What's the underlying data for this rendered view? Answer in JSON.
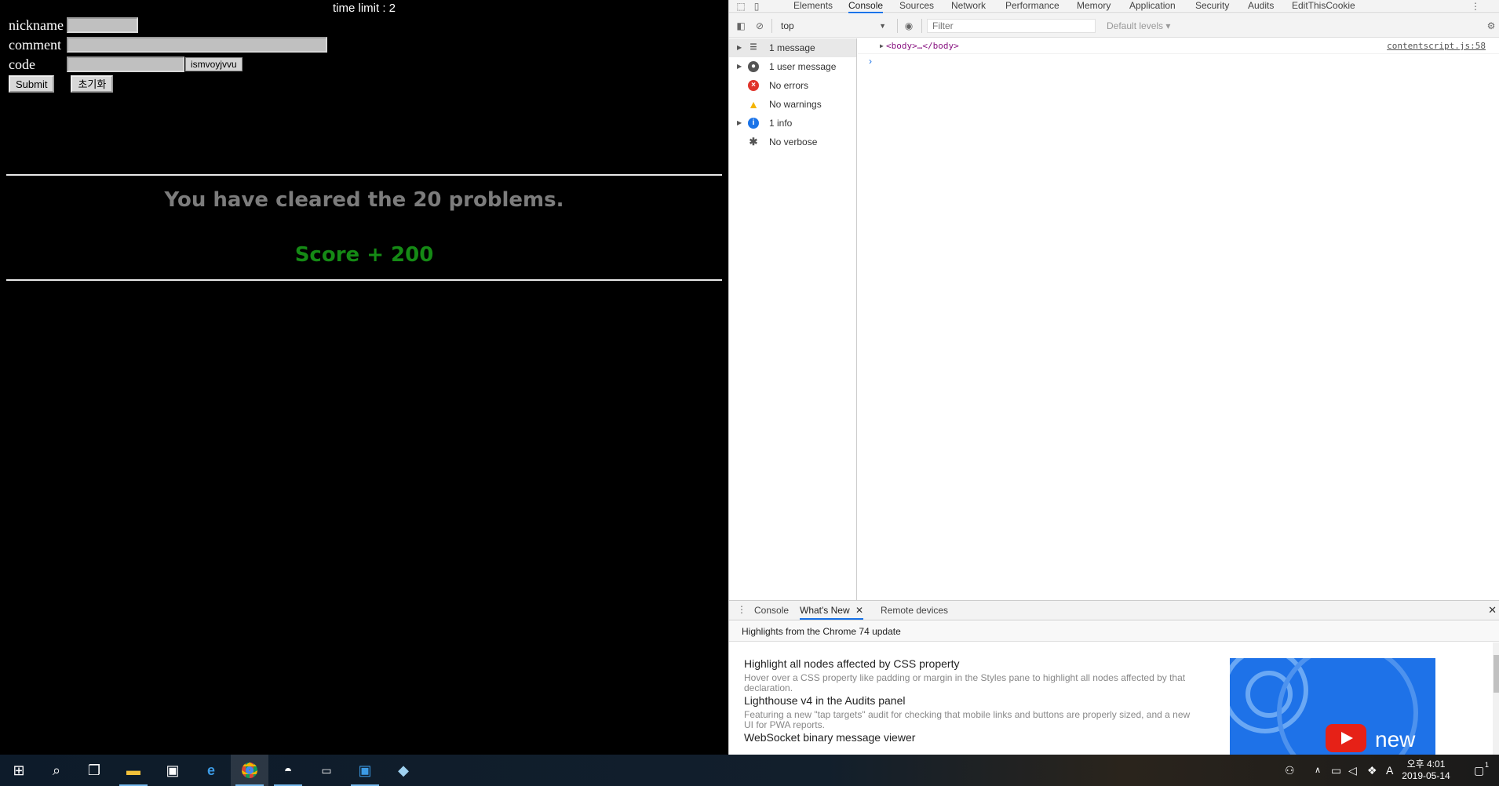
{
  "page": {
    "time_limit": "time limit : 2",
    "form": {
      "nickname_label": "nickname",
      "nickname_value": "",
      "comment_label": "comment",
      "comment_value": "",
      "code_label": "code",
      "code_value": "",
      "code_chip": "ismvoyjvvu",
      "submit_label": "Submit",
      "reset_label": "초기화"
    },
    "cleared_text": "You have cleared the 20 problems.",
    "score_text": "Score + 200"
  },
  "devtools": {
    "tabs": [
      "Elements",
      "Console",
      "Sources",
      "Network",
      "Performance",
      "Memory",
      "Application",
      "Security",
      "Audits",
      "EditThisCookie"
    ],
    "active_tab": "Console",
    "context": "top",
    "filter_placeholder": "Filter",
    "levels": "Default levels ▾",
    "sidebar": [
      {
        "label": "1 message",
        "icon": "list-icon"
      },
      {
        "label": "1 user message",
        "icon": "user-icon"
      },
      {
        "label": "No errors",
        "icon": "error-icon"
      },
      {
        "label": "No warnings",
        "icon": "warning-icon"
      },
      {
        "label": "1 info",
        "icon": "info-icon"
      },
      {
        "label": "No verbose",
        "icon": "bug-icon"
      }
    ],
    "console_entry": {
      "tag": "<body>…</body>",
      "source": "contentscript.js:58"
    },
    "drawer_tabs": [
      "Console",
      "What's New",
      "Remote devices"
    ],
    "whats_new": {
      "header": "Highlights from the Chrome 74 update",
      "items": [
        {
          "title": "Highlight all nodes affected by CSS property",
          "desc": "Hover over a CSS property like padding or margin in the Styles pane to highlight all nodes affected by that declaration."
        },
        {
          "title": "Lighthouse v4 in the Audits panel",
          "desc": "Featuring a new \"tap targets\" audit for checking that mobile links and buttons are properly sized, and a new UI for PWA reports."
        },
        {
          "title": "WebSocket binary message viewer",
          "desc": ""
        }
      ],
      "thumb_text": "new"
    }
  },
  "taskbar": {
    "apps": [
      "windows-start-icon",
      "search-icon",
      "task-view-icon",
      "file-explorer-icon",
      "store-icon",
      "edge-icon",
      "chrome-icon",
      "paint-icon",
      "terminal-icon",
      "app-icon",
      "notepad-icon"
    ],
    "clock_time": "오후 4:01",
    "clock_date": "2019-05-14",
    "ime": "A",
    "notification_count": "1"
  },
  "colors": {
    "score_green": "#158a15",
    "cleared_gray": "#7c7c7c",
    "accent_blue": "#1a73e8"
  }
}
